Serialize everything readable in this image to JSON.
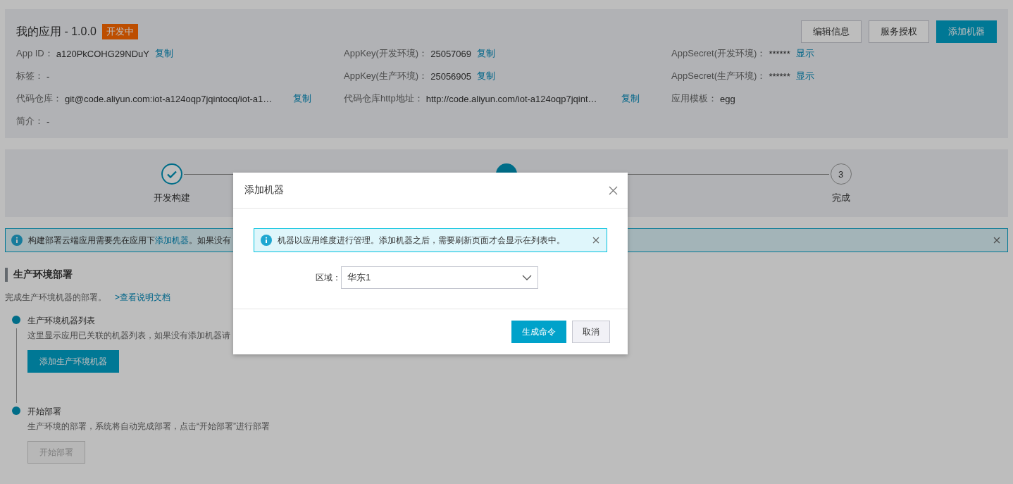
{
  "app": {
    "title": "我的应用 - 1.0.0",
    "status_badge": "开发中",
    "actions": [
      {
        "label": "编辑信息",
        "kind": "default"
      },
      {
        "label": "服务授权",
        "kind": "default"
      },
      {
        "label": "添加机器",
        "kind": "primary"
      }
    ],
    "rows": [
      [
        {
          "label": "App ID：",
          "value": "a120PkCOHG29NDuY",
          "action": "复制"
        },
        {
          "label": "AppKey(开发环境)：",
          "value": "25057069",
          "action": "复制"
        },
        {
          "label": "AppSecret(开发环境)：",
          "value": "******",
          "action": "显示"
        }
      ],
      [
        {
          "label": "标签：",
          "value": "-"
        },
        {
          "label": "AppKey(生产环境)：",
          "value": "25056905",
          "action": "复制"
        },
        {
          "label": "AppSecret(生产环境)：",
          "value": "******",
          "action": "显示"
        }
      ],
      [
        {
          "label": "代码仓库：",
          "value": "git@code.aliyun.com:iot-a124oqp7jqintocq/iot-a1…",
          "action": "复制"
        },
        {
          "label": "代码仓库http地址：",
          "value": "http://code.aliyun.com/iot-a124oqp7jqint…",
          "action": "复制"
        },
        {
          "label": "应用模板：",
          "value": "egg"
        }
      ],
      [
        {
          "label": "简介：",
          "value": "-"
        }
      ]
    ]
  },
  "steps": [
    {
      "label": "开发构建",
      "done": true,
      "active": false
    },
    {
      "done": false,
      "active": true
    },
    {
      "number": "3",
      "label": "完成",
      "done": false,
      "active": false
    }
  ],
  "notice": {
    "text": "构建部署云端应用需要先在应用下",
    "link": "添加机器",
    "text_after": "。如果没有"
  },
  "section": {
    "title": "生产环境部署",
    "description": "完成生产环境机器的部署。",
    "doc_link": ">查看说明文档",
    "timeline": [
      {
        "title": "生产环境机器列表",
        "description": "这里显示应用已关联的机器列表，如果没有添加机器请",
        "button": {
          "label": "添加生产环境机器",
          "disabled": false
        }
      },
      {
        "title": "开始部署",
        "description": "生产环境的部署，系统将自动完成部署，点击“开始部署”进行部署",
        "button": {
          "label": "开始部署",
          "disabled": true
        }
      }
    ]
  },
  "dialog": {
    "title": "添加机器",
    "alert": "机器以应用维度进行管理。添加机器之后，需要刷新页面才会显示在列表中。",
    "fields": [
      {
        "label": "区域：",
        "value": "华东1"
      }
    ],
    "buttons": [
      {
        "label": "生成命令",
        "kind": "primary"
      },
      {
        "label": "取消",
        "kind": "default"
      }
    ]
  }
}
